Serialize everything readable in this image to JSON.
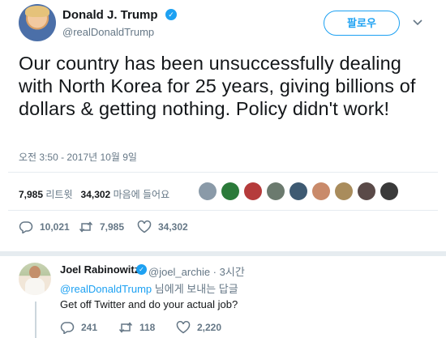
{
  "tweet": {
    "author_name": "Donald J. Trump",
    "author_handle": "@realDonaldTrump",
    "follow_label": "팔로우",
    "text": "Our country has been unsuccessfully dealing with North Korea for 25 years, giving billions of dollars & getting nothing. Policy didn't work!",
    "timestamp": "오전 3:50 - 2017년 10월 9일",
    "retweets_count": "7,985",
    "retweets_label": "리트윗",
    "likes_count": "34,302",
    "likes_label": "마음에 들어요",
    "actions": {
      "reply_count": "10,021",
      "retweet_count": "7,985",
      "like_count": "34,302"
    }
  },
  "reply": {
    "author_name": "Joel Rabinowitz",
    "author_handle": "@joel_archie · 3시간",
    "reply_to_handle": "@realDonaldTrump",
    "reply_to_suffix": " 님에게 보내는 답글",
    "text": "Get off Twitter and do your actual job?",
    "actions": {
      "reply_count": "241",
      "retweet_count": "118",
      "like_count": "2,220"
    }
  },
  "colors": {
    "accent": "#1da1f2",
    "secondary_text": "#657786",
    "primary_text": "#14171a",
    "divider": "#e6ecf0"
  },
  "icons": [
    "verified-badge-icon",
    "caret-down-icon",
    "reply-icon",
    "retweet-icon",
    "heart-icon"
  ]
}
